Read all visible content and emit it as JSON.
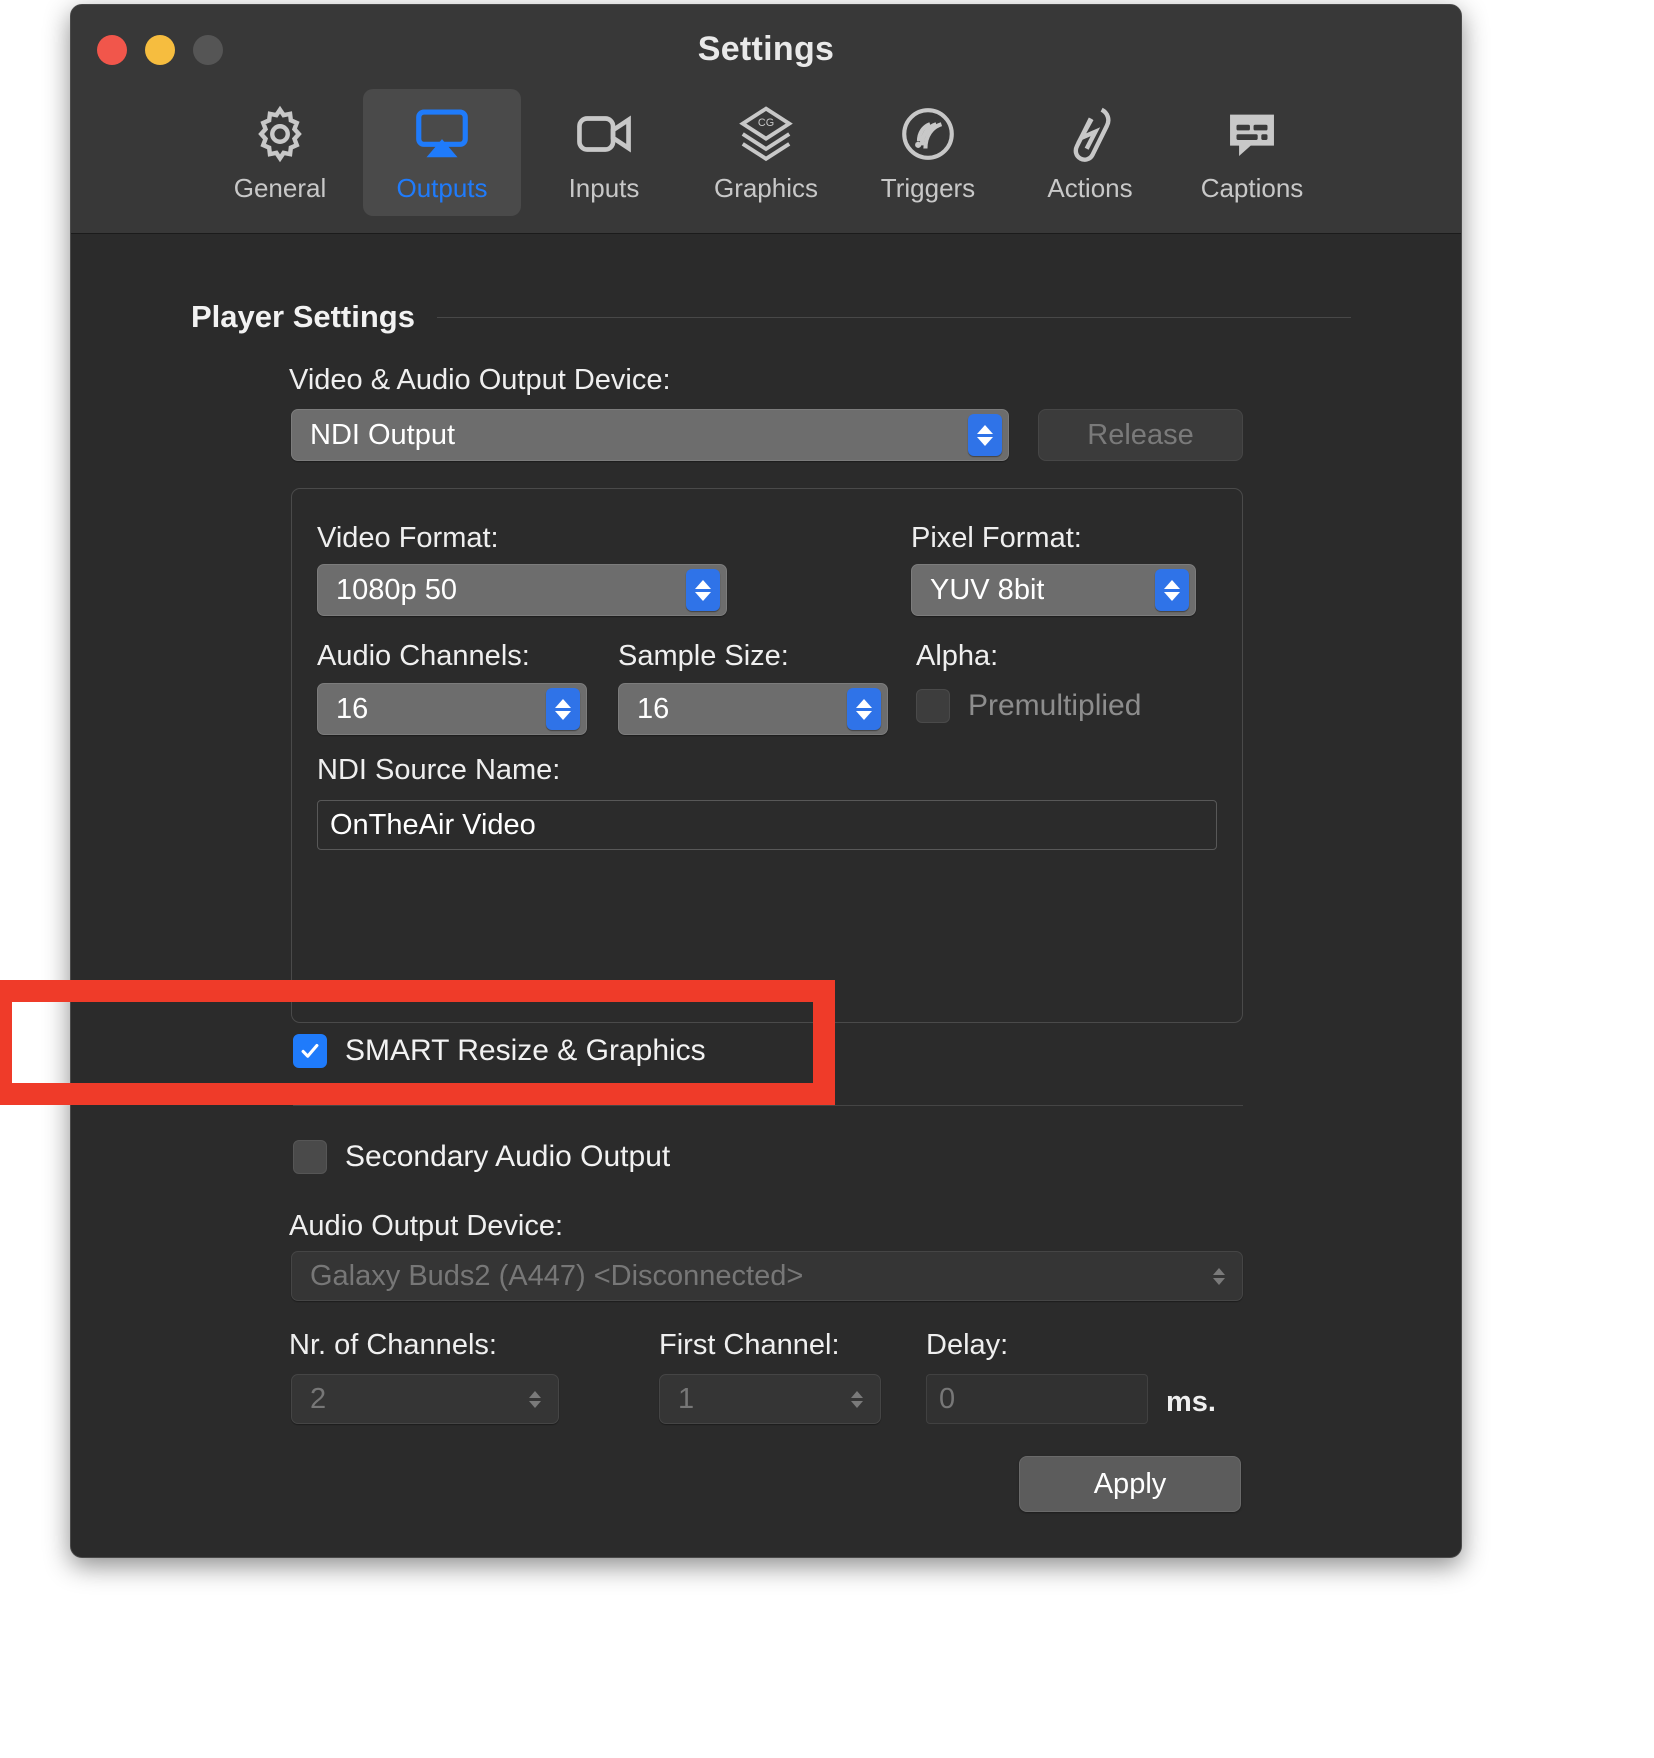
{
  "window": {
    "title": "Settings",
    "traffic_lights": [
      "close",
      "minimize",
      "zoom"
    ]
  },
  "toolbar": {
    "items": [
      {
        "label": "General",
        "icon": "gear-icon",
        "active": false
      },
      {
        "label": "Outputs",
        "icon": "airplay-icon",
        "active": true
      },
      {
        "label": "Inputs",
        "icon": "video-camera-icon",
        "active": false
      },
      {
        "label": "Graphics",
        "icon": "layers-cg-icon",
        "active": false
      },
      {
        "label": "Triggers",
        "icon": "signal-wave-icon",
        "active": false
      },
      {
        "label": "Actions",
        "icon": "lightning-tag-icon",
        "active": false
      },
      {
        "label": "Captions",
        "icon": "caption-bubble-icon",
        "active": false
      }
    ]
  },
  "player_settings": {
    "section_title": "Player Settings",
    "video_audio_output_device": {
      "label": "Video & Audio Output Device:",
      "value": "NDI Output"
    },
    "release_button": {
      "label": "Release",
      "enabled": false
    },
    "device_group": {
      "video_format": {
        "label": "Video Format:",
        "value": "1080p 50"
      },
      "pixel_format": {
        "label": "Pixel Format:",
        "value": "YUV 8bit"
      },
      "audio_channels": {
        "label": "Audio Channels:",
        "value": "16"
      },
      "sample_size": {
        "label": "Sample Size:",
        "value": "16"
      },
      "alpha": {
        "label": "Alpha:",
        "checkbox_label": "Premultiplied",
        "checked": false,
        "enabled": false
      },
      "ndi_source_name": {
        "label": "NDI Source Name:",
        "value": "OnTheAir Video"
      }
    },
    "smart_resize": {
      "label": "SMART Resize & Graphics",
      "checked": true
    }
  },
  "secondary_audio": {
    "toggle": {
      "label": "Secondary Audio Output",
      "checked": false
    },
    "audio_output_device": {
      "label": "Audio Output Device:",
      "value": "Galaxy Buds2 (A447) <Disconnected>",
      "enabled": false
    },
    "nr_of_channels": {
      "label": "Nr. of Channels:",
      "value": "2",
      "enabled": false
    },
    "first_channel": {
      "label": "First Channel:",
      "value": "1",
      "enabled": false
    },
    "delay": {
      "label": "Delay:",
      "value": "0",
      "unit": "ms.",
      "enabled": false
    }
  },
  "footer": {
    "apply_button": "Apply"
  },
  "annotation": {
    "type": "highlight-rectangle",
    "color": "#ef3b29",
    "target": "SMART Resize & Graphics"
  },
  "colors": {
    "accent_blue": "#1f7bfb",
    "stepper_blue": "#2f73e8",
    "window_bg": "#2b2b2b",
    "titlebar_bg": "#383838",
    "annotation_red": "#ef3b29"
  }
}
